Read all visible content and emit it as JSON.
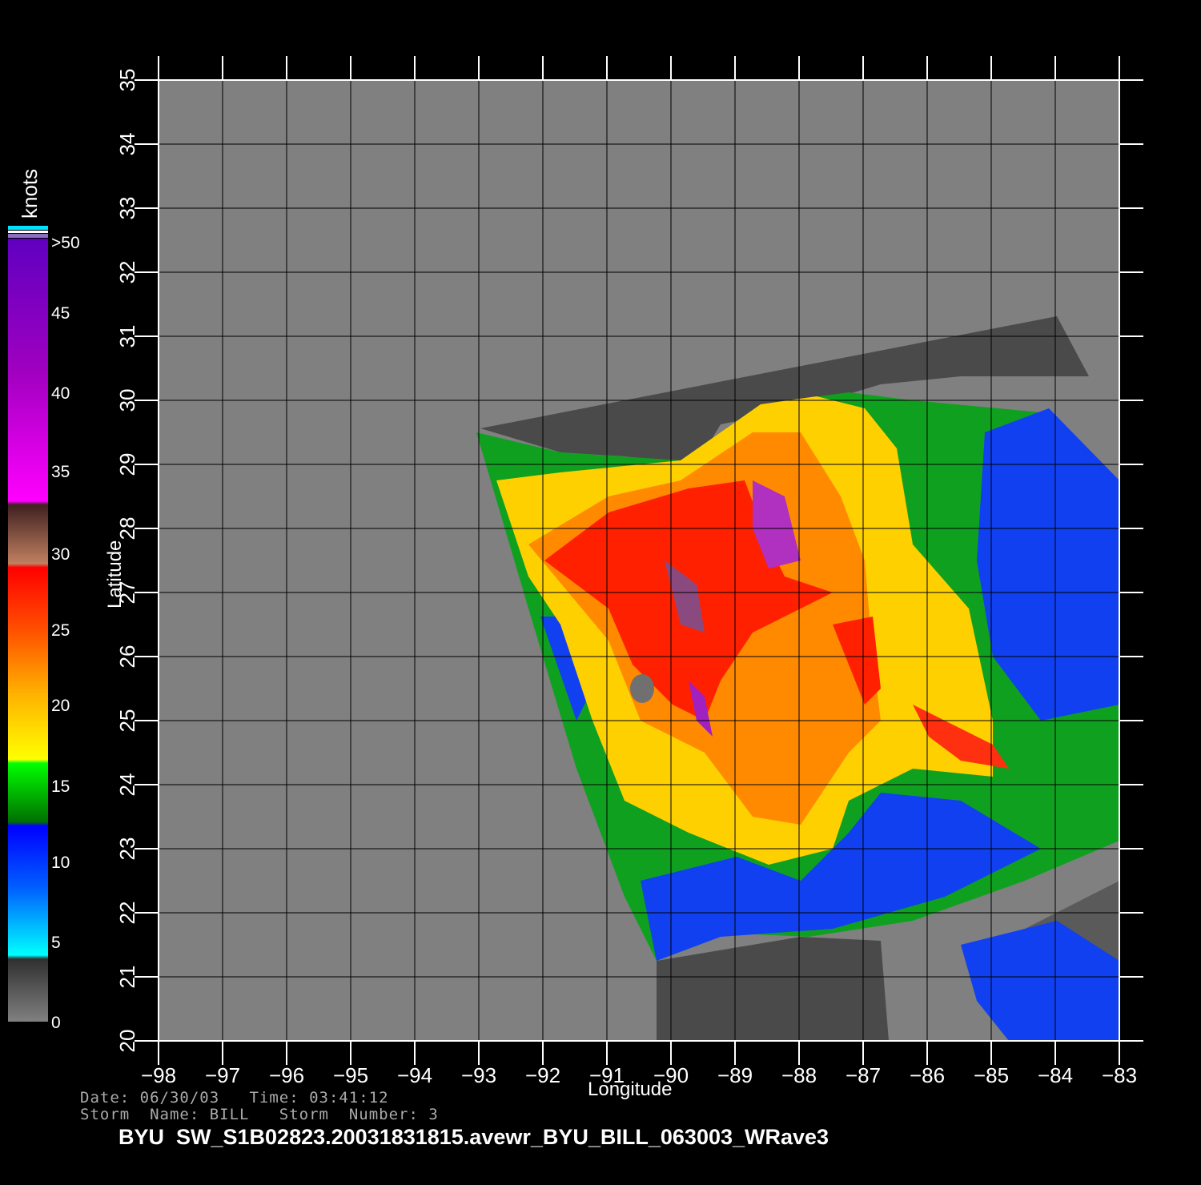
{
  "map": {
    "lon_ticks": [
      -98,
      -97,
      -96,
      -95,
      -94,
      -93,
      -92,
      -91,
      -90,
      -89,
      -88,
      -87,
      -86,
      -85,
      -84,
      -83
    ],
    "lat_ticks": [
      20,
      21,
      22,
      23,
      24,
      25,
      26,
      27,
      28,
      29,
      30,
      31,
      32,
      33,
      34,
      35
    ],
    "lon_range": [
      -98,
      -83
    ],
    "lat_range": [
      20,
      35
    ],
    "xlabel": "Longitude",
    "ylabel": "Latitude",
    "background_color": "#808080",
    "land_color": "#5a5a5a"
  },
  "colorbar": {
    "units": "knots",
    "labels": [
      ">50",
      "45",
      "40",
      "35",
      "30",
      "25",
      "20",
      "15",
      "10",
      "5",
      "0"
    ],
    "scale_colors": [
      "#808080",
      "#303030",
      "#00ffff",
      "#0060ff",
      "#0000ff",
      "#007000",
      "#00ff00",
      "#ffff00",
      "#ffb000",
      "#ff5000",
      "#ff0000",
      "#c08060",
      "#402020",
      "#ff00ff",
      "#a000c0",
      "#6000c0"
    ]
  },
  "footer": {
    "date_line": "Date: 06/30/03   Time: 03:41:12",
    "storm_line": "Storm  Name: BILL   Storm  Number: 3",
    "product": "BYU  SW_S1B02823.20031831815.avewr_BYU_BILL_063003_WRave3"
  }
}
